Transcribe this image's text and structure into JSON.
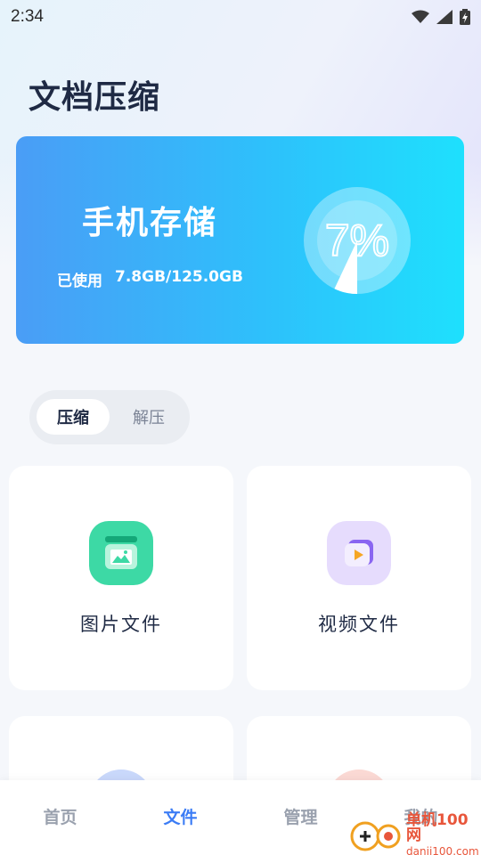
{
  "status_bar": {
    "time": "2:34"
  },
  "header": {
    "title": "文档压缩"
  },
  "storage": {
    "title": "手机存储",
    "used_label": "已使用",
    "used_value": "7.8GB/125.0GB",
    "percent_text": "7%",
    "used_fraction": 0.07
  },
  "mode_switch": {
    "options": [
      "压缩",
      "解压"
    ],
    "selected": "压缩"
  },
  "tiles": [
    {
      "label": "图片文件",
      "icon": "image-file-icon",
      "color": "#3dd9a5"
    },
    {
      "label": "视频文件",
      "icon": "video-file-icon",
      "color": "#a58bf7"
    },
    {
      "label": "",
      "icon": "partial-icon",
      "color": "#c9d8fb"
    },
    {
      "label": "",
      "icon": "partial-icon",
      "color": "#fbd9d4"
    }
  ],
  "bottom_nav": {
    "items": [
      "首页",
      "文件",
      "管理",
      "我的"
    ],
    "active": "文件"
  },
  "watermark": {
    "title": "单机100网",
    "url": "danji100.com"
  },
  "colors": {
    "accent": "#3b7cf5",
    "card_gradient_start": "#4a9df6",
    "card_gradient_end": "#1ee0fd",
    "title": "#1f2a44"
  }
}
